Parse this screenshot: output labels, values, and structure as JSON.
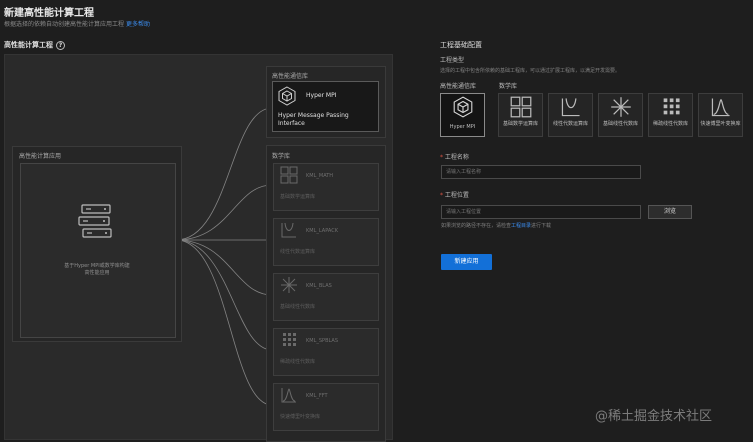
{
  "header": {
    "title": "新建高性能计算工程",
    "subtitle": "根据选择的依赖自动创建高性能计算应用工程",
    "subtitle_link": "更多帮助"
  },
  "left": {
    "section_title": "高性能计算工程",
    "app_group_label": "高性能计算应用",
    "app_desc": "基于Hyper MPI或数学库构建高性能应用",
    "comm_group_label": "高性能通信库",
    "mpi_card": {
      "name": "Hyper MPI",
      "full_name": "Hyper Message Passing Interface"
    },
    "math_group_label": "数学库",
    "libs": [
      {
        "name": "KML_MATH",
        "desc": "基础数学运算库",
        "icon": "grid-icon"
      },
      {
        "name": "KML_LAPACK",
        "desc": "线性代数运算库",
        "icon": "lapack-icon"
      },
      {
        "name": "KML_BLAS",
        "desc": "基础线性代数库",
        "icon": "blas-icon"
      },
      {
        "name": "KML_SPBLAS",
        "desc": "稀疏线性代数库",
        "icon": "spblas-icon"
      },
      {
        "name": "KML_FFT",
        "desc": "快速傅里叶变换库",
        "icon": "fft-icon"
      }
    ]
  },
  "right": {
    "panel_title": "工程基础配置",
    "type_label": "工程类型",
    "type_desc": "选择的工程中包含所依赖的基础工程库，可以通过扩展工程库，以满足开发需要。",
    "comm_lib_label": "高性能通信库",
    "math_lib_label": "数学库",
    "tiles": [
      {
        "label": "Hyper MPI",
        "selected": true,
        "icon": "hyper-mpi-icon"
      },
      {
        "label": "基础数学运算库",
        "selected": false,
        "icon": "grid-icon"
      },
      {
        "label": "线性代数运算库",
        "selected": false,
        "icon": "lapack-icon"
      },
      {
        "label": "基础线性代数库",
        "selected": false,
        "icon": "blas-icon"
      },
      {
        "label": "稀疏线性代数库",
        "selected": false,
        "icon": "spblas-icon"
      },
      {
        "label": "快速傅里叶变换库",
        "selected": false,
        "icon": "fft-icon"
      }
    ],
    "name_label": "工程名称",
    "name_placeholder": "请输入工程名称",
    "location_label": "工程位置",
    "location_placeholder": "请输入工程位置",
    "browse_label": "浏览",
    "location_hint": "如果浏览的路径不存在，请检查",
    "location_hint_link": "工程目录",
    "location_hint_tail": "进行下载",
    "create_label": "新建应用"
  },
  "watermark": "@稀土掘金技术社区",
  "colors": {
    "accent": "#1370d8",
    "link": "#3c8ef0",
    "background": "#1e1e1e"
  }
}
